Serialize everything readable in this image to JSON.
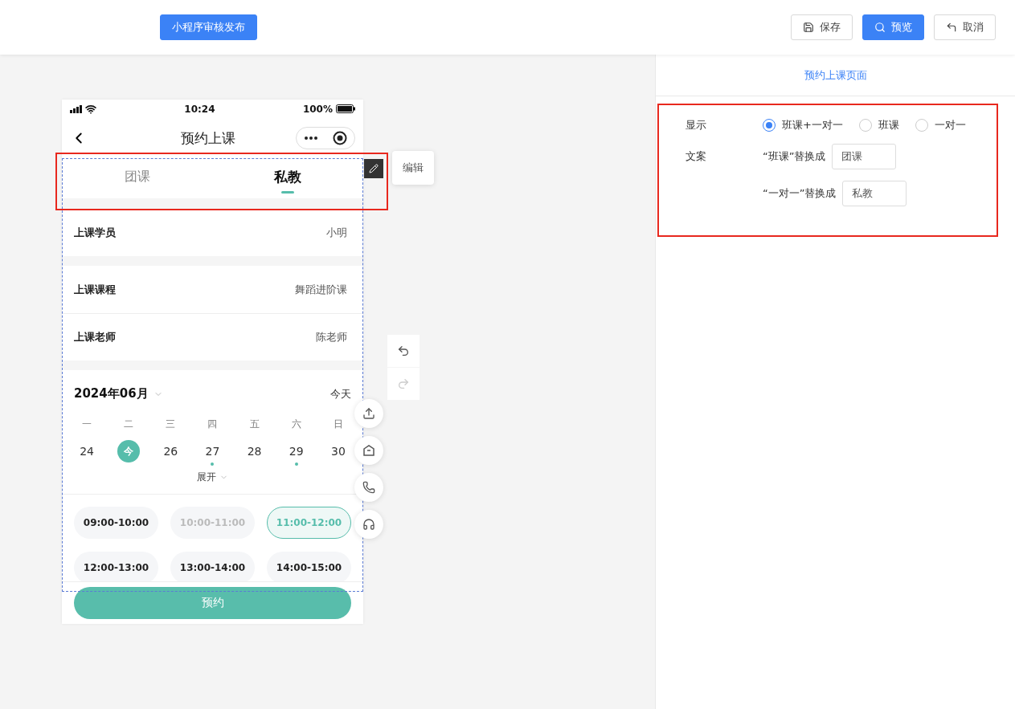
{
  "header": {
    "publish_button": "小程序审核发布",
    "buttons": [
      {
        "kind": "save",
        "label": "保存",
        "primary": false
      },
      {
        "kind": "preview",
        "label": "预览",
        "primary": true
      },
      {
        "kind": "cancel",
        "label": "取消",
        "primary": false
      }
    ]
  },
  "phone": {
    "status": {
      "time": "10:24",
      "battery": "100%"
    },
    "title": "预约上课",
    "tabs": [
      {
        "label": "团课",
        "selected": false
      },
      {
        "label": "私教",
        "selected": true
      }
    ],
    "edit_tooltip": "编辑",
    "sections": [
      [
        {
          "label": "上课学员",
          "value": "小明"
        }
      ],
      [
        {
          "label": "上课课程",
          "value": "舞蹈进阶课"
        },
        {
          "label": "上课老师",
          "value": "陈老师"
        }
      ]
    ],
    "calendar": {
      "month": "2024年06月",
      "today": "今天",
      "weekdays": [
        "一",
        "二",
        "三",
        "四",
        "五",
        "六",
        "日"
      ],
      "days": [
        {
          "label": "24",
          "selected": false,
          "dot": false
        },
        {
          "label": "今",
          "selected": true,
          "dot": false
        },
        {
          "label": "26",
          "selected": false,
          "dot": false
        },
        {
          "label": "27",
          "selected": false,
          "dot": true
        },
        {
          "label": "28",
          "selected": false,
          "dot": false
        },
        {
          "label": "29",
          "selected": false,
          "dot": true
        },
        {
          "label": "30",
          "selected": false,
          "dot": false
        }
      ],
      "expand": "展开"
    },
    "slots": [
      {
        "label": "09:00-10:00",
        "disabled": false,
        "selected": false
      },
      {
        "label": "10:00-11:00",
        "disabled": true,
        "selected": false
      },
      {
        "label": "11:00-12:00",
        "disabled": false,
        "selected": true
      },
      {
        "label": "12:00-13:00",
        "disabled": false,
        "selected": false
      },
      {
        "label": "13:00-14:00",
        "disabled": false,
        "selected": false
      },
      {
        "label": "14:00-15:00",
        "disabled": false,
        "selected": false
      }
    ],
    "book_button": "预约"
  },
  "settings": {
    "title": "预约上课页面",
    "display_label": "显示",
    "options": [
      {
        "label": "班课+一对一",
        "selected": true
      },
      {
        "label": "班课",
        "selected": false
      },
      {
        "label": "一对一",
        "selected": false
      }
    ],
    "copy_label": "文案",
    "replacements": [
      {
        "label": "“班课”替换成",
        "value": "团课"
      },
      {
        "label": "“一对一”替换成",
        "value": "私教"
      }
    ]
  }
}
